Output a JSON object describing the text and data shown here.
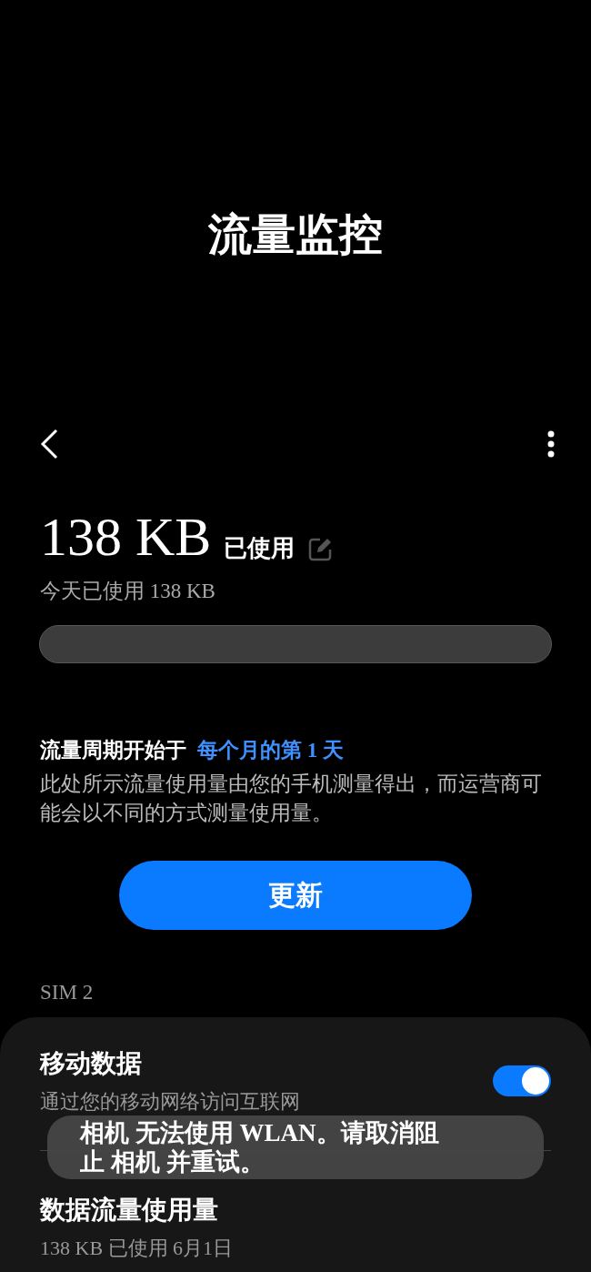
{
  "page_title": "流量监控",
  "usage": {
    "amount": "138 KB",
    "suffix": "已使用",
    "today": "今天已使用 138 KB",
    "level": 0
  },
  "cycle": {
    "label": "流量周期开始于",
    "value": "每个月的第 1 天"
  },
  "description": "此处所示流量使用量由您的手机测量得出，而运营商可能会以不同的方式测量使用量。",
  "update_button": "更新",
  "section_label": "SIM 2",
  "settings": [
    {
      "kind": "toggle",
      "title": "移动数据",
      "subtitle": "通过您的移动网络访问互联网",
      "on": true
    },
    {
      "kind": "link",
      "title": "数据流量使用量",
      "subtitle": "138 KB 已使用 6月1日"
    }
  ],
  "toast": "相机 无法使用 WLAN。请取消阻止 相机 并重试。"
}
